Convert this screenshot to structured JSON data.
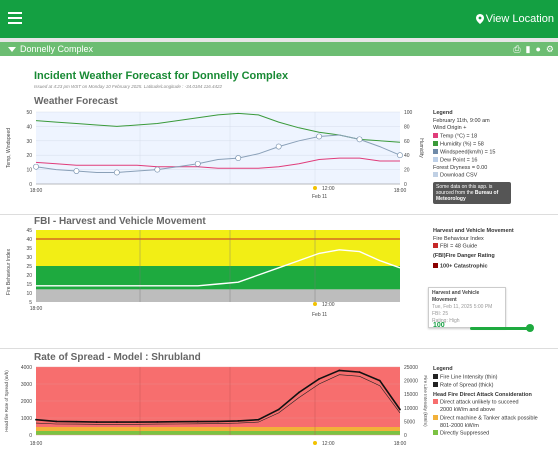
{
  "header": {
    "view_location": "View Location"
  },
  "complex": {
    "name": "Donnelly Complex"
  },
  "forecast": {
    "title": "Incident Weather Forecast for Donnelly Complex",
    "issued": "Issued at 4:23 pm WST on Monday 10 February 2025. Latitude/Longitude : -34.0184 116.4422"
  },
  "weather": {
    "title": "Weather Forecast",
    "ylabel_left": "Temp, Windspeed",
    "ylabel_right": "Humidity",
    "yticks_left": [
      "50",
      "40",
      "30",
      "20",
      "10",
      "0"
    ],
    "yticks_right": [
      "100",
      "80",
      "60",
      "40",
      "20",
      "0"
    ],
    "xticks": [
      "18:00",
      "12:00",
      "18:00"
    ],
    "xsub": "Feb 11",
    "legend": {
      "title": "Legend",
      "items": [
        "February 11th, 9:00 am",
        "Wind Origin +",
        "Temp (°C) = 18",
        "Humidity (%) = 58",
        "Windspeed(km/h) = 15",
        "Dew Point = 16",
        "Forest Dryness = 0.00",
        "Download CSV"
      ]
    },
    "notice": "Some data on this app. is sourced from the ",
    "notice_link": "Bureau of Meteorology",
    "colors": {
      "temp": "#e03c7a",
      "humidity": "#3a9a3a",
      "wind": "#8aa0b8",
      "dew": "#c0d0e4"
    },
    "chart_data": {
      "type": "line",
      "x": [
        "18:00",
        "00:00",
        "06:00",
        "12:00",
        "18:00"
      ],
      "ylim": [
        0,
        50
      ],
      "series": [
        {
          "name": "Temp",
          "values": [
            15,
            14,
            13,
            13,
            13,
            13,
            12,
            12,
            12,
            11,
            11,
            11,
            12,
            14,
            17,
            18,
            18,
            16,
            16
          ]
        },
        {
          "name": "Humidity",
          "values": [
            88,
            86,
            84,
            82,
            80,
            82,
            84,
            88,
            92,
            96,
            98,
            96,
            86,
            78,
            72,
            68,
            62,
            60,
            58
          ]
        },
        {
          "name": "Windspeed",
          "values": [
            12,
            10,
            9,
            8,
            8,
            9,
            10,
            12,
            14,
            17,
            18,
            21,
            26,
            30,
            33,
            34,
            31,
            26,
            20
          ]
        }
      ]
    }
  },
  "fbi": {
    "title": "FBI - Harvest and Vehicle Movement",
    "ylabel": "Fire Behaviour Index",
    "yticks": [
      "45",
      "40",
      "35",
      "30",
      "25",
      "20",
      "15",
      "10",
      "5"
    ],
    "xticks": [
      "18:00",
      "12:00"
    ],
    "xsub": "Feb 11",
    "legend": {
      "title": "Harvest and Vehicle Movement",
      "sub": "Fire Behaviour Index",
      "guide": "FBI = 48 Guide",
      "rating_title": "(FBI)Fire Danger Rating",
      "rating": "100+ Catastrophic"
    },
    "tooltip": {
      "title": "Harvest and Vehicle Movement",
      "date": "Tue, Feb 11, 2025 5:00 PM",
      "fbi": "FBI: 25",
      "rating": "Rating: High"
    },
    "slider_value": "100",
    "colors": {
      "catastrophic": "#f2ee15",
      "extreme": "#1eaa3f",
      "high": "#bbbbbb"
    },
    "chart_data": {
      "type": "area",
      "ylim": [
        5,
        45
      ],
      "values": [
        14,
        14,
        14,
        14,
        14,
        14,
        14,
        14,
        14,
        15,
        16,
        20,
        24,
        28,
        32,
        34,
        33,
        28,
        24
      ]
    }
  },
  "ros": {
    "title": "Rate of Spread - Model : Shrubland",
    "ylabel_left": "Head fire Rate of Spread (m/h)",
    "ylabel_right": "Fire Line Intensity (kW/m)",
    "yticks_left": [
      "4000",
      "3000",
      "2000",
      "1000",
      "0"
    ],
    "yticks_right": [
      "25000",
      "20000",
      "15000",
      "10000",
      "5000",
      "0"
    ],
    "xticks": [
      "18:00",
      "12:00",
      "18:00"
    ],
    "xsub": "Feb 11",
    "legend": {
      "title": "Legend",
      "items": [
        "Fire Line Intensity (thin)",
        "Rate of Spread (thick)"
      ],
      "h2": "Head Fire Direct Attack Consideration",
      "d1": "Direct attack unlikely to succeed",
      "d1b": "2000 kW/m and above",
      "d2": "Direct machine & Tanker attack possible",
      "d2b": "801-2000 kW/m",
      "d3": "Directly Suppressed"
    },
    "colors": {
      "unlikely": "#f76e6e",
      "machine": "#f2b13a",
      "suppressed": "#7cc243"
    },
    "chart_data": {
      "type": "line",
      "ylim": [
        0,
        4000
      ],
      "series": [
        {
          "name": "Rate of Spread",
          "values": [
            900,
            800,
            780,
            760,
            760,
            760,
            770,
            780,
            790,
            800,
            830,
            900,
            1500,
            2500,
            3300,
            3800,
            3700,
            3200,
            1500
          ]
        },
        {
          "name": "Fire Line Intensity",
          "values": [
            700,
            650,
            640,
            630,
            630,
            630,
            640,
            650,
            660,
            670,
            700,
            760,
            1300,
            2200,
            3000,
            3550,
            3450,
            2900,
            1300
          ]
        }
      ]
    }
  }
}
